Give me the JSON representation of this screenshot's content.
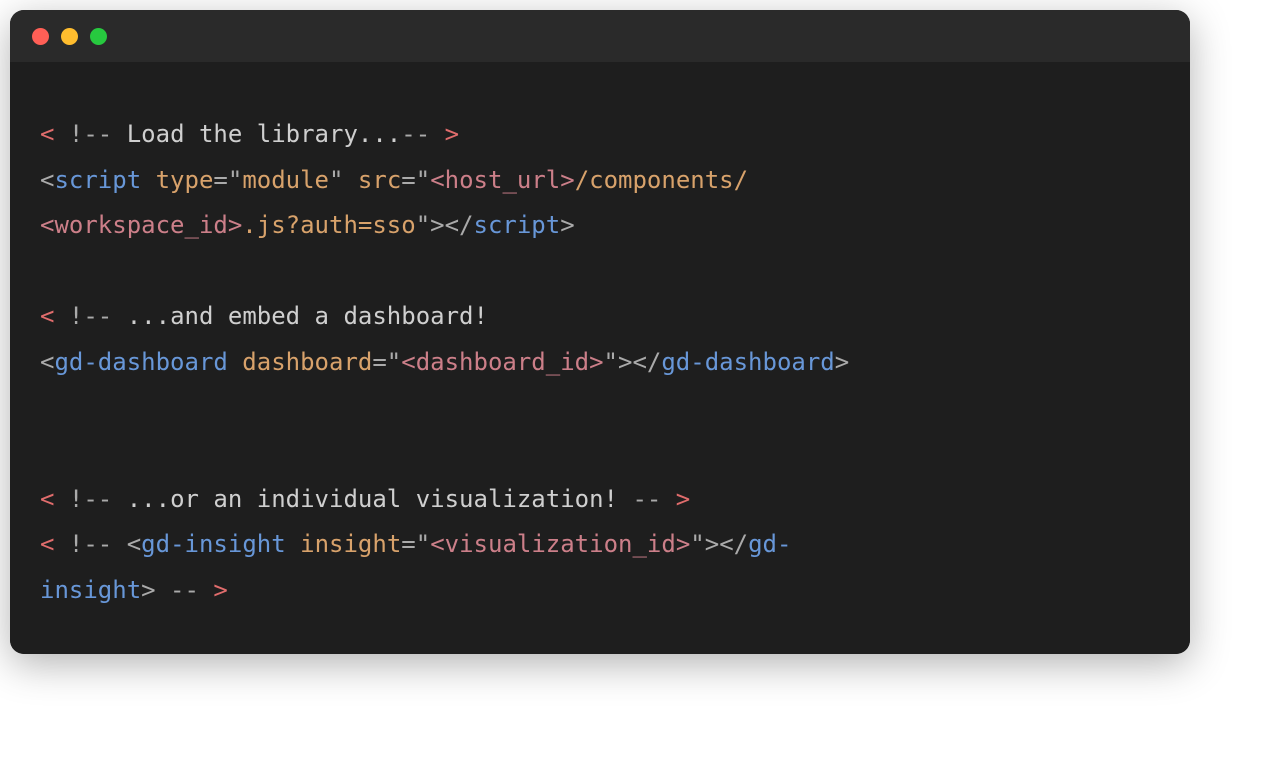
{
  "colors": {
    "red": "#ff5f56",
    "yellow": "#ffbd2e",
    "green": "#27c93f",
    "bg_window": "#1e1e1e",
    "bg_titlebar": "#2a2a2a",
    "syntax_red": "#e06c6c",
    "syntax_blue": "#6897d8",
    "syntax_attr": "#d8a26b",
    "syntax_var": "#cc7f89",
    "syntax_gray": "#aaaaaa",
    "syntax_text": "#cfcfcf"
  },
  "code": {
    "l1": {
      "open": "<",
      "bang": " !",
      "dash1": "-- ",
      "text": "Load the library...",
      "dash2": "--",
      "close": " >"
    },
    "l2": {
      "open": "<",
      "tag": "script",
      "sp1": " ",
      "attr1": "type",
      "eq1": "=",
      "q1a": "\"",
      "val1": "module",
      "q1b": "\"",
      "sp2": " ",
      "attr2": "src",
      "eq2": "=",
      "q2a": "\"",
      "var1a": "<",
      "var1b": "host_url",
      "var1c": ">",
      "path1": "/components/"
    },
    "l3": {
      "var2a": "<",
      "var2b": "workspace_id",
      "var2c": ">",
      "path2": ".js?auth=sso",
      "q2b": "\"",
      "close1": ">",
      "open2": "<",
      "slash": "/",
      "tag": "script",
      "close2": ">"
    },
    "l5": {
      "open": "<",
      "bang": " !",
      "dash": "-- ",
      "text": "...and embed a dashboard!"
    },
    "l6": {
      "open": "<",
      "tag": "gd-dashboard",
      "sp": " ",
      "attr": "dashboard",
      "eq": "=",
      "qa": "\"",
      "vara": "<",
      "varb": "dashboard_id",
      "varc": ">",
      "qb": "\"",
      "close1": ">",
      "open2": "<",
      "slash": "/",
      "tag2": "gd-dashboard",
      "close2": ">"
    },
    "l9": {
      "open": "<",
      "bang": " !",
      "dash1": "-- ",
      "text": "...or an individual visualization!",
      "dash2": " --",
      "close": " >"
    },
    "l10": {
      "open": "<",
      "bang": " !",
      "dash": "-- ",
      "open2": "<",
      "tag": "gd-insight",
      "sp": " ",
      "attr": "insight",
      "eq": "=",
      "qa": "\"",
      "vara": "<",
      "varb": "visualization_id",
      "varc": ">",
      "qb": "\"",
      "close1": ">",
      "open3": "<",
      "slash": "/",
      "tag2": "gd-"
    },
    "l11": {
      "tag2b": "insight",
      "close2": ">",
      "dash": " --",
      "close": " >"
    }
  }
}
